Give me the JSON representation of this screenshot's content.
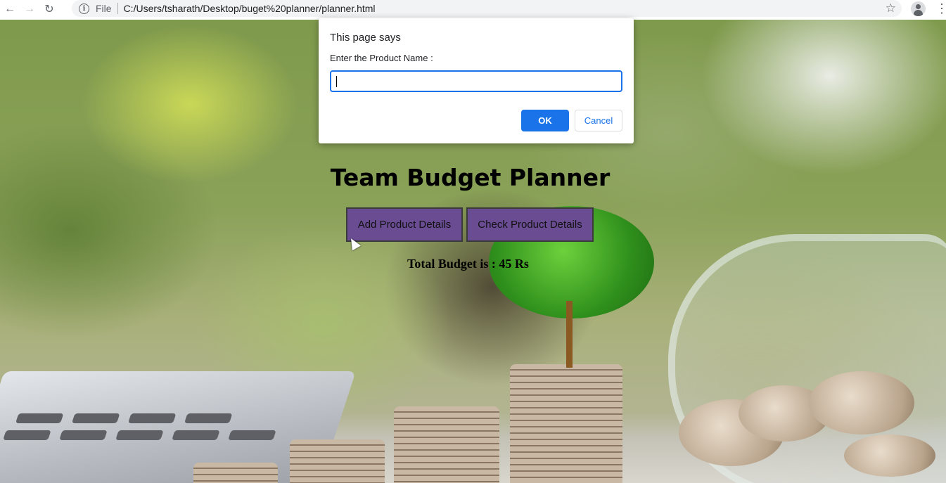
{
  "browser": {
    "back_icon": "arrow-left-icon",
    "forward_icon": "arrow-right-icon",
    "reload_icon": "reload-icon",
    "scheme_label": "File",
    "url": "C:/Users/tsharath/Desktop/buget%20planner/planner.html",
    "bookmark_icon": "star-icon",
    "profile_icon": "avatar-icon",
    "menu_icon": "kebab-menu-icon"
  },
  "dialog": {
    "title": "This page says",
    "message": "Enter the Product Name :",
    "input_value": "",
    "ok_label": "OK",
    "cancel_label": "Cancel",
    "accent_color": "#1a73e8"
  },
  "app": {
    "title": "Team Budget Planner",
    "add_button_label": "Add Product Details",
    "check_button_label": "Check Product Details",
    "budget_text": "Total Budget is : 45 Rs",
    "button_color": "#6a4c93"
  }
}
